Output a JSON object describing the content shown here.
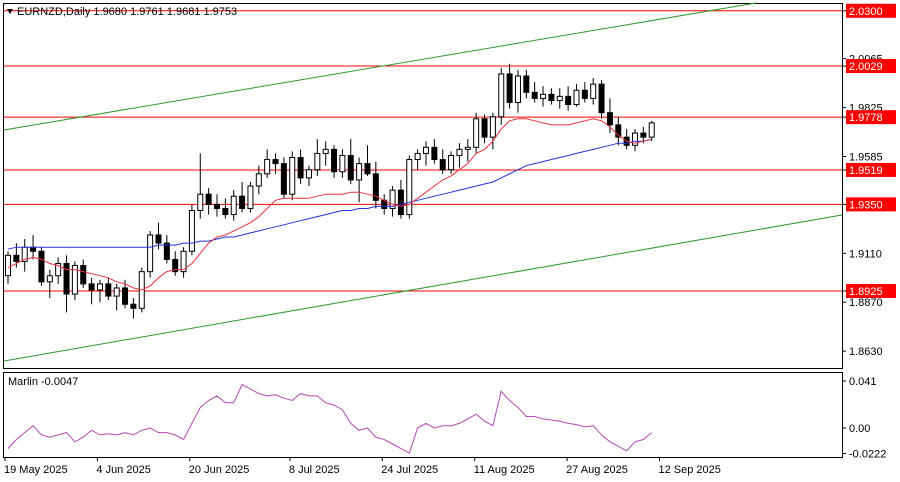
{
  "chart_header": {
    "symbol_info": "EURNZD,Daily  1.9680 1.9761 1.9681 1.9753"
  },
  "indicator": {
    "label": "Marlin -0.0047",
    "axis_labels": [
      "0.041",
      "0.00",
      "-0.0222"
    ]
  },
  "colors": {
    "level_line": "#ff0000",
    "channel": "#2e9a2e",
    "fast_ma": "#e8323c",
    "slow_ma": "#2233dd",
    "oscillator": "#b04ab4",
    "candle": "#000000"
  },
  "chart_data": {
    "type": "candlestick",
    "symbol": "EURNZD",
    "timeframe": "Daily",
    "ohlc_last": {
      "open": 1.968,
      "high": 1.9761,
      "low": 1.9681,
      "close": 1.9753
    },
    "price_axis_labels": [
      "2.0300",
      "2.0065",
      "2.0029",
      "1.9825",
      "1.9778",
      "1.9585",
      "1.9519",
      "1.9350",
      "1.9110",
      "1.8925",
      "1.8870",
      "1.8630"
    ],
    "highlighted_levels": [
      2.03,
      2.0029,
      1.9778,
      1.9519,
      1.935,
      1.8925
    ],
    "date_labels": [
      "19 May 2025",
      "4 Jun 2025",
      "20 Jun 2025",
      "8 Jul 2025",
      "24 Jul 2025",
      "11 Aug 2025",
      "27 Aug 2025",
      "12 Sep 2025"
    ],
    "candles": [
      [
        1.9,
        1.912,
        1.896,
        1.91
      ],
      [
        1.91,
        1.916,
        1.904,
        1.907
      ],
      [
        1.907,
        1.918,
        1.902,
        1.914
      ],
      [
        1.914,
        1.92,
        1.908,
        1.912
      ],
      [
        1.912,
        1.914,
        1.895,
        1.897
      ],
      [
        1.897,
        1.903,
        1.889,
        1.9
      ],
      [
        1.9,
        1.909,
        1.896,
        1.906
      ],
      [
        1.906,
        1.91,
        1.882,
        1.891
      ],
      [
        1.891,
        1.907,
        1.888,
        1.905
      ],
      [
        1.905,
        1.908,
        1.894,
        1.896
      ],
      [
        1.896,
        1.899,
        1.886,
        1.893
      ],
      [
        1.893,
        1.898,
        1.887,
        1.896
      ],
      [
        1.896,
        1.899,
        1.888,
        1.89
      ],
      [
        1.89,
        1.896,
        1.883,
        1.894
      ],
      [
        1.894,
        1.898,
        1.884,
        1.886
      ],
      [
        1.886,
        1.889,
        1.879,
        1.884
      ],
      [
        1.884,
        1.904,
        1.882,
        1.902
      ],
      [
        1.902,
        1.922,
        1.899,
        1.92
      ],
      [
        1.92,
        1.926,
        1.913,
        1.916
      ],
      [
        1.916,
        1.92,
        1.906,
        1.908
      ],
      [
        1.908,
        1.912,
        1.9,
        1.902
      ],
      [
        1.902,
        1.914,
        1.899,
        1.912
      ],
      [
        1.912,
        1.935,
        1.91,
        1.932
      ],
      [
        1.932,
        1.96,
        1.928,
        1.94
      ],
      [
        1.94,
        1.943,
        1.93,
        1.935
      ],
      [
        1.935,
        1.94,
        1.929,
        1.933
      ],
      [
        1.933,
        1.938,
        1.928,
        1.93
      ],
      [
        1.93,
        1.942,
        1.927,
        1.939
      ],
      [
        1.939,
        1.946,
        1.931,
        1.933
      ],
      [
        1.933,
        1.946,
        1.931,
        1.944
      ],
      [
        1.944,
        1.954,
        1.94,
        1.95
      ],
      [
        1.95,
        1.962,
        1.948,
        1.957
      ],
      [
        1.957,
        1.96,
        1.95,
        1.955
      ],
      [
        1.955,
        1.958,
        1.938,
        1.94
      ],
      [
        1.94,
        1.961,
        1.937,
        1.958
      ],
      [
        1.958,
        1.962,
        1.945,
        1.948
      ],
      [
        1.948,
        1.954,
        1.944,
        1.952
      ],
      [
        1.952,
        1.967,
        1.949,
        1.96
      ],
      [
        1.96,
        1.966,
        1.954,
        1.962
      ],
      [
        1.962,
        1.964,
        1.948,
        1.951
      ],
      [
        1.951,
        1.962,
        1.948,
        1.959
      ],
      [
        1.959,
        1.967,
        1.945,
        1.947
      ],
      [
        1.947,
        1.958,
        1.936,
        1.955
      ],
      [
        1.955,
        1.964,
        1.949,
        1.95
      ],
      [
        1.95,
        1.956,
        1.933,
        1.937
      ],
      [
        1.937,
        1.94,
        1.93,
        1.933
      ],
      [
        1.933,
        1.944,
        1.929,
        1.942
      ],
      [
        1.942,
        1.947,
        1.928,
        1.93
      ],
      [
        1.93,
        1.959,
        1.928,
        1.957
      ],
      [
        1.957,
        1.962,
        1.952,
        1.96
      ],
      [
        1.96,
        1.966,
        1.954,
        1.963
      ],
      [
        1.963,
        1.967,
        1.955,
        1.957
      ],
      [
        1.957,
        1.962,
        1.95,
        1.952
      ],
      [
        1.952,
        1.961,
        1.95,
        1.959
      ],
      [
        1.959,
        1.965,
        1.953,
        1.962
      ],
      [
        1.962,
        1.967,
        1.956,
        1.963
      ],
      [
        1.963,
        1.98,
        1.96,
        1.977
      ],
      [
        1.977,
        1.979,
        1.965,
        1.968
      ],
      [
        1.968,
        1.98,
        1.962,
        1.978
      ],
      [
        1.978,
        2.002,
        1.974,
        1.999
      ],
      [
        1.999,
        2.004,
        1.982,
        1.985
      ],
      [
        1.985,
        2.001,
        1.98,
        1.998
      ],
      [
        1.998,
        2.001,
        1.987,
        1.99
      ],
      [
        1.99,
        1.995,
        1.985,
        1.987
      ],
      [
        1.987,
        1.993,
        1.983,
        1.989
      ],
      [
        1.989,
        1.992,
        1.984,
        1.986
      ],
      [
        1.986,
        1.992,
        1.982,
        1.988
      ],
      [
        1.988,
        1.993,
        1.981,
        1.984
      ],
      [
        1.984,
        1.994,
        1.983,
        1.991
      ],
      [
        1.991,
        1.995,
        1.985,
        1.987
      ],
      [
        1.987,
        1.997,
        1.984,
        1.994
      ],
      [
        1.994,
        1.996,
        1.977,
        1.98
      ],
      [
        1.98,
        1.987,
        1.97,
        1.974
      ],
      [
        1.974,
        1.978,
        1.964,
        1.968
      ],
      [
        1.968,
        1.972,
        1.962,
        1.964
      ],
      [
        1.964,
        1.972,
        1.961,
        1.97
      ],
      [
        1.97,
        1.973,
        1.965,
        1.968
      ],
      [
        1.968,
        1.976,
        1.966,
        1.975
      ]
    ],
    "fast_ma": [
      1.904,
      1.906,
      1.908,
      1.909,
      1.908,
      1.906,
      1.905,
      1.903,
      1.903,
      1.902,
      1.901,
      1.9,
      1.899,
      1.897,
      1.896,
      1.894,
      1.893,
      1.895,
      1.899,
      1.902,
      1.903,
      1.903,
      1.906,
      1.911,
      1.916,
      1.919,
      1.92,
      1.922,
      1.924,
      1.926,
      1.929,
      1.933,
      1.937,
      1.938,
      1.938,
      1.938,
      1.938,
      1.939,
      1.94,
      1.94,
      1.94,
      1.941,
      1.941,
      1.94,
      1.939,
      1.937,
      1.935,
      1.934,
      1.935,
      1.938,
      1.941,
      1.944,
      1.947,
      1.949,
      1.952,
      1.955,
      1.96,
      1.962,
      1.966,
      1.972,
      1.976,
      1.977,
      1.977,
      1.976,
      1.975,
      1.974,
      1.974,
      1.974,
      1.975,
      1.976,
      1.977,
      1.976,
      1.973,
      1.969,
      1.966,
      1.965,
      1.966,
      1.967
    ],
    "slow_ma": [
      1.913,
      1.914,
      1.914,
      1.914,
      1.914,
      1.914,
      1.914,
      1.914,
      1.914,
      1.914,
      1.914,
      1.914,
      1.914,
      1.914,
      1.914,
      1.914,
      1.914,
      1.914,
      1.915,
      1.915,
      1.915,
      1.916,
      1.916,
      1.917,
      1.917,
      1.918,
      1.919,
      1.919,
      1.92,
      1.921,
      1.922,
      1.923,
      1.924,
      1.925,
      1.926,
      1.927,
      1.928,
      1.929,
      1.93,
      1.931,
      1.932,
      1.932,
      1.933,
      1.933,
      1.934,
      1.934,
      1.934,
      1.935,
      1.936,
      1.937,
      1.938,
      1.939,
      1.94,
      1.941,
      1.942,
      1.943,
      1.944,
      1.945,
      1.946,
      1.948,
      1.95,
      1.952,
      1.954,
      1.955,
      1.956,
      1.957,
      1.958,
      1.959,
      1.96,
      1.961,
      1.962,
      1.963,
      1.964,
      1.965,
      1.965,
      1.966,
      1.966,
      1.967
    ],
    "oscillator": [
      -0.018,
      -0.01,
      -0.004,
      0.002,
      -0.006,
      -0.008,
      -0.006,
      -0.004,
      -0.012,
      -0.008,
      -0.002,
      -0.006,
      -0.005,
      -0.006,
      -0.004,
      -0.006,
      -0.002,
      0.0,
      -0.004,
      -0.004,
      -0.006,
      -0.01,
      0.004,
      0.018,
      0.024,
      0.028,
      0.022,
      0.022,
      0.038,
      0.034,
      0.03,
      0.028,
      0.029,
      0.026,
      0.024,
      0.03,
      0.028,
      0.028,
      0.022,
      0.02,
      0.016,
      0.004,
      -0.002,
      0.0,
      -0.008,
      -0.01,
      -0.014,
      -0.018,
      -0.022,
      0.0,
      0.004,
      0.0,
      0.002,
      0.002,
      0.004,
      0.008,
      0.012,
      0.006,
      0.002,
      0.032,
      0.024,
      0.018,
      0.01,
      0.01,
      0.008,
      0.007,
      0.006,
      0.004,
      0.003,
      0.001,
      0.002,
      -0.006,
      -0.012,
      -0.016,
      -0.02,
      -0.012,
      -0.01,
      -0.004
    ]
  }
}
